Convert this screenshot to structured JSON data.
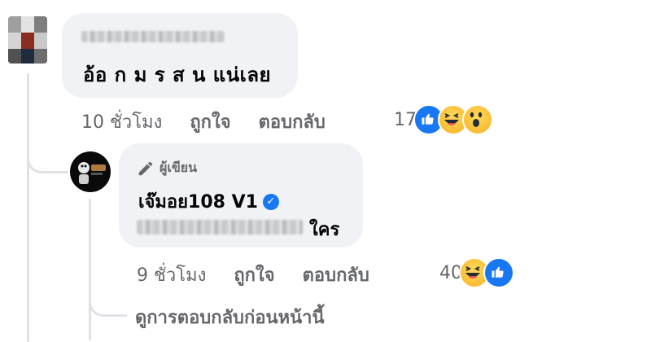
{
  "comment1": {
    "text": "อ้อ ก ม ร ส น แน่เลย",
    "time": "10 ชั่วโมง",
    "like_label": "ถูกใจ",
    "reply_label": "ตอบกลับ",
    "reaction_count": "17",
    "reactions": [
      "like-icon",
      "haha-icon",
      "wow-icon"
    ]
  },
  "reply1": {
    "badge": "ผู้เขียน",
    "author": "เจ๊มอย108 V1",
    "verified": "✓",
    "text_suffix": "ใคร",
    "time": "9 ชั่วโมง",
    "like_label": "ถูกใจ",
    "reply_label": "ตอบกลับ",
    "reaction_count": "40",
    "reactions": [
      "haha-icon",
      "like-icon"
    ]
  },
  "view_previous": "ดูการตอบกลับก่อนหน้านี้",
  "colors": {
    "bubble": "#f0f2f5",
    "muted_text": "#65676b",
    "like_blue": "#1877f2",
    "thread_line": "#dfe1e5"
  }
}
